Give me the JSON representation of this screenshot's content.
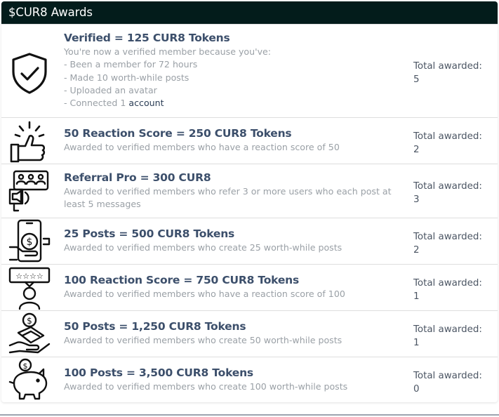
{
  "header": {
    "title": "$CUR8 Awards"
  },
  "total_label": "Total awarded:",
  "awards": [
    {
      "title": "Verified = 125 CUR8 Tokens",
      "desc_intro": "You're now a verified member because you've:",
      "desc_items": [
        "- Been a member for 72 hours",
        "- Made 10 worth-while posts",
        "- Uploaded an avatar",
        "- Connected 1 "
      ],
      "desc_link": "account",
      "count": "5",
      "icon": "shield-check-icon"
    },
    {
      "title": "50 Reaction Score = 250 CUR8 Tokens",
      "desc": "Awarded to verified members who have a reaction score of 50",
      "count": "2",
      "icon": "thumbs-up-icon"
    },
    {
      "title": "Referral Pro = 300 CUR8",
      "desc": "Awarded to verified members who refer 3 or more users who each post at least 5 messages",
      "count": "3",
      "icon": "referral-megaphone-icon"
    },
    {
      "title": "25 Posts = 500 CUR8 Tokens",
      "desc": "Awarded to verified members who create 25 worth-while posts",
      "count": "2",
      "icon": "phone-dollar-icon"
    },
    {
      "title": "100 Reaction Score = 750 CUR8 Tokens",
      "desc": "Awarded to verified members who have a reaction score of 100",
      "count": "1",
      "icon": "rating-person-icon"
    },
    {
      "title": "50 Posts = 1,250 CUR8 Tokens",
      "desc": "Awarded to verified members who create 50 worth-while posts",
      "count": "1",
      "icon": "hand-money-icon"
    },
    {
      "title": "100 Posts = 3,500 CUR8 Tokens",
      "desc": "Awarded to verified members who create 100 worth-while posts",
      "count": "0",
      "icon": "piggy-bank-icon"
    }
  ]
}
